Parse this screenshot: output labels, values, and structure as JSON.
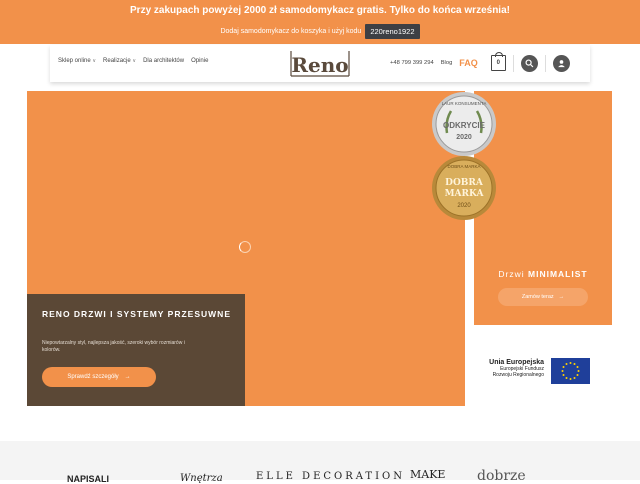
{
  "promo": {
    "title": "Przy zakupach powyżej 2000 zł samodomykacz gratis. Tylko do końca września!",
    "line": "Dodaj samodomykacz do koszyka i użyj kodu",
    "code": "220reno1922"
  },
  "header": {
    "logo": "Reno",
    "nav": [
      {
        "label": "Sklep online"
      },
      {
        "label": "Realizacje"
      },
      {
        "label": "Dla architektów"
      },
      {
        "label": "Opinie"
      }
    ],
    "phone": "+48 799 399 294",
    "blog": "Blog",
    "faq": "FAQ",
    "cart_count": "0"
  },
  "hero": {
    "title": "RENO DRZWI I SYSTEMY PRZESUWNE",
    "desc": "Niepowtarzalny styl, najlepsza jakość, szeroki wybór rozmiarów i kolorów.",
    "button": "Sprawdź szczegóły"
  },
  "side": {
    "title_prefix": "Drzwi",
    "title_bold": "MINIMALIST",
    "button": "Zamów teraz",
    "badge1": {
      "top": "LAUR KONSUMENTA",
      "main": "ODKRYCIE",
      "year": "2020"
    },
    "badge2": {
      "top": "DOBRA MARKA",
      "main1": "DOBRA",
      "main2": "MARKA",
      "year": "2020"
    }
  },
  "eu": {
    "title": "Unia Europejska",
    "sub1": "Europejski Fundusz",
    "sub2": "Rozwoju Regionalnego"
  },
  "footer_strip": {
    "napisali": "NAPISALI",
    "logos": [
      "Wnętrza",
      "ELLE DECORATION",
      "MAKE",
      "dobrze"
    ]
  },
  "colors": {
    "accent": "#f2914a",
    "card": "#5b4836",
    "dark": "#3d3f44"
  }
}
